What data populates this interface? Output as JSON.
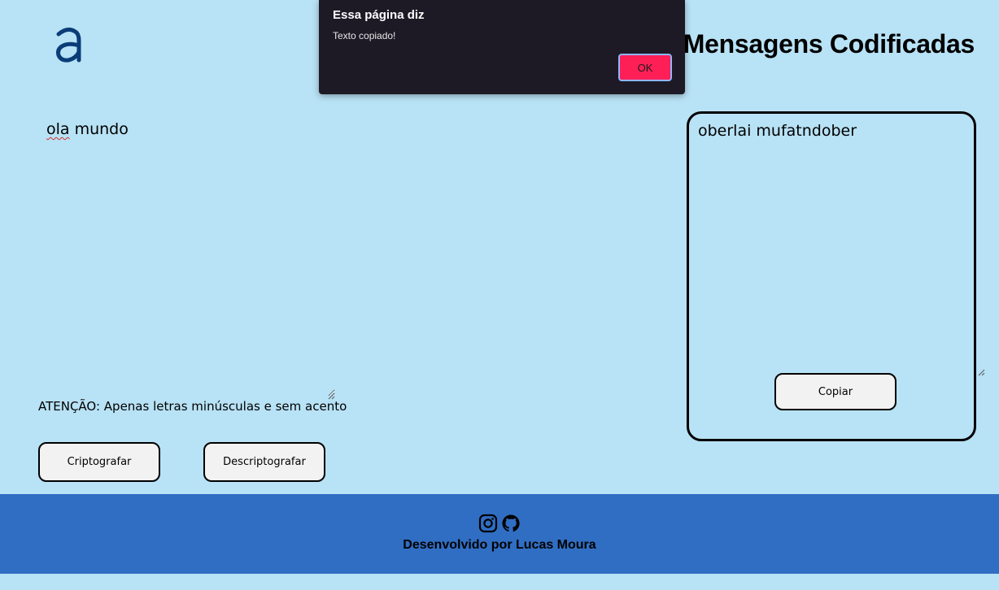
{
  "header": {
    "logo_alt": "a",
    "title": "Mensagens Codificadas"
  },
  "input": {
    "value_misspelled": "ola",
    "value_rest": " mundo"
  },
  "warning": "ATENÇÃO: Apenas letras minúsculas e sem acento",
  "buttons": {
    "encrypt_label": "Criptografar",
    "decrypt_label": "Descriptografar",
    "copy_label": "Copiar"
  },
  "output": {
    "value": "oberlai mufatndober"
  },
  "footer": {
    "icons": [
      "instagram-icon",
      "github-icon"
    ],
    "credit": "Desenvolvido por Lucas Moura"
  },
  "dialog": {
    "title": "Essa página diz",
    "message": "Texto copiado!",
    "ok_label": "OK"
  },
  "colors": {
    "background": "#b8e2f5",
    "footer": "#306ec3",
    "logo": "#0a3d78",
    "dialog_bg": "#1d1a26",
    "dialog_ok": "#ff1f57"
  }
}
